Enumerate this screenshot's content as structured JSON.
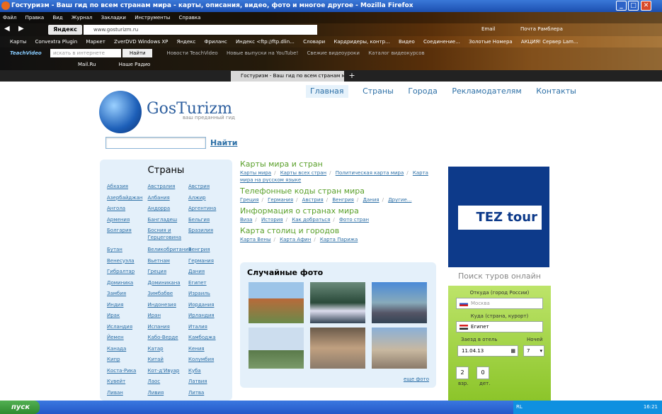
{
  "window_title": "Гостуризм - Ваш гид по всем странам мира - карты, описания, видео, фото и многое другое - Mozilla Firefox",
  "menu": [
    "Файл",
    "Правка",
    "Вид",
    "Журнал",
    "Закладки",
    "Инструменты",
    "Справка"
  ],
  "nav": {
    "yandex": "Яндекс",
    "url": "www.gosturizm.ru",
    "email": "Email",
    "mail_service": "Почта Рамблера"
  },
  "bookmarks": [
    "Карты",
    "Convextra Plugin",
    "Маркет",
    "ZverDVD Windows XP",
    "Яндекс",
    "Фриланс",
    "Индекс <ftp://ftp.dlin...",
    "Словари",
    "Кардридеры, контр...",
    "Видео",
    "Соединение...",
    "Золотые Номера",
    "АКЦИЯ! Сервер Lam..."
  ],
  "teachvideo": {
    "logo": "TeachVideo",
    "search_placeholder": "искать в интернете",
    "find": "Найти",
    "items": [
      "Новости TeachVideo",
      "Новые выпуски на YouTube!",
      "Свежие видеоуроки",
      "Каталог видеокурсов"
    ]
  },
  "mailbar": {
    "mail": "Mail.Ru",
    "radio": "Наше Радио"
  },
  "tab": {
    "title": "Гостуризм - Ваш гид по всем странам м...",
    "new": "+"
  },
  "site": {
    "logo": "GosTurizm",
    "slogan": "ваш преданный гид",
    "nav": [
      "Главная",
      "Страны",
      "Города",
      "Рекламодателям",
      "Контакты"
    ],
    "search_btn": "Найти",
    "countries_title": "Страны",
    "countries": [
      [
        "Абхазия",
        "Австралия",
        "Австрия"
      ],
      [
        "Азербайджан",
        "Албания",
        "Алжир"
      ],
      [
        "Ангола",
        "Андорра",
        "Аргентина"
      ],
      [
        "Армения",
        "Бангладеш",
        "Бельгия"
      ],
      [
        "Болгария",
        "Босния и Герцеговина",
        "Бразилия"
      ],
      [
        "Бутан",
        "Великобритания",
        "Венгрия"
      ],
      [
        "Венесуэла",
        "Вьетнам",
        "Германия"
      ],
      [
        "Гибралтар",
        "Греция",
        "Дания"
      ],
      [
        "Доминика",
        "Доминикана",
        "Египет"
      ],
      [
        "Замбия",
        "Зимбабве",
        "Израиль"
      ],
      [
        "Индия",
        "Индонезия",
        "Иордания"
      ],
      [
        "Ирак",
        "Иран",
        "Ирландия"
      ],
      [
        "Исландия",
        "Испания",
        "Италия"
      ],
      [
        "Йемен",
        "Кабо-Верде",
        "Камбоджа"
      ],
      [
        "Канада",
        "Катар",
        "Кения"
      ],
      [
        "Кипр",
        "Китай",
        "Колумбия"
      ],
      [
        "Коста-Рика",
        "Кот-д'Ивуар",
        "Куба"
      ],
      [
        "Кувейт",
        "Лаос",
        "Латвия"
      ],
      [
        "Ливан",
        "Ливия",
        "Литва"
      ]
    ],
    "sections": [
      {
        "title": "Карты мира и стран",
        "links": [
          "Карты мира",
          "Карты всех стран",
          "Политическая карта мира",
          "Карта мира на русском языке"
        ]
      },
      {
        "title": "Телефонные коды стран мира",
        "links": [
          "Греция",
          "Германия",
          "Австрия",
          "Венгрия",
          "Дания",
          "Другие..."
        ]
      },
      {
        "title": "Информация о странах мира",
        "links": [
          "Виза",
          "История",
          "Как добраться",
          "Фото стран"
        ]
      },
      {
        "title": "Карта столиц и городов",
        "links": [
          "Карта Вены",
          "Карта Афин",
          "Карта Парижа"
        ]
      }
    ],
    "photos_title": "Случайные фото",
    "more_photos": "еще фото",
    "banner": "TEZ tour",
    "tour": {
      "title": "Поиск туров онлайн",
      "from_label": "Откуда (город России)",
      "from_value": "Москва",
      "to_label": "Куда (страна, курорт)",
      "to_value": "Египет",
      "date_label": "Заезд в отель",
      "date_value": "11.04.13",
      "nights_label": "Ночей",
      "nights_value": "7",
      "adults": "2",
      "kids": "0",
      "adults_label": "взр.",
      "kids_label": "дет."
    }
  },
  "taskbar": {
    "start": "пуск",
    "lang": "RL",
    "time": "16:21"
  }
}
